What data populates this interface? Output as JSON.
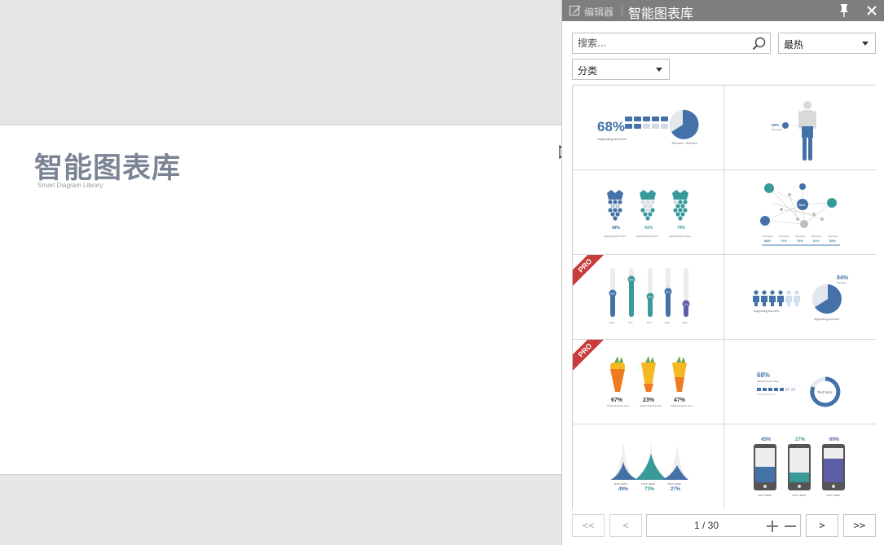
{
  "slide": {
    "title": "智能图表库",
    "subtitle": "Smart Diagram Library"
  },
  "panel": {
    "header": {
      "edit_label": "编辑器",
      "title": "智能图表库"
    },
    "search": {
      "placeholder": "搜索..."
    },
    "sort_select": {
      "value": "最热"
    },
    "category_select": {
      "value": "分类"
    },
    "templates": [
      {
        "name": "percent-pie",
        "pro": false,
        "texts": {
          "big": "68%",
          "support": "Supporting text here",
          "pie": "Text here / Text here"
        }
      },
      {
        "name": "human-body",
        "pro": false,
        "texts": {
          "pct": "68%",
          "label": "Text here"
        }
      },
      {
        "name": "grapes",
        "pro": false,
        "texts": {
          "p1": "68%",
          "p2": "41%",
          "p3": "79%",
          "support": "Supporting text here"
        }
      },
      {
        "name": "network",
        "pro": false,
        "texts": {
          "node": "Text",
          "v1": "88%",
          "v2": "73%",
          "v3": "74%",
          "v4": "64%",
          "v5": "58%",
          "label": "Text here"
        }
      },
      {
        "name": "vertical-bars",
        "pro": true,
        "texts": {
          "v1": "52%",
          "v2": "98%",
          "v3": "40%",
          "v4": "56%",
          "v5": "21%",
          "label": "Text"
        }
      },
      {
        "name": "people-pie",
        "pro": false,
        "texts": {
          "pct": "84%",
          "label": "Text here",
          "support": "Supporting text here"
        }
      },
      {
        "name": "carrots",
        "pro": true,
        "texts": {
          "p1": "67%",
          "p2": "23%",
          "p3": "47%",
          "support": "Supporting text here"
        }
      },
      {
        "name": "donut-bar",
        "pro": false,
        "texts": {
          "pct": "68%",
          "center": "Text here",
          "support": "Supporting text here"
        }
      },
      {
        "name": "mountains",
        "pro": false,
        "texts": {
          "p1": "49%",
          "p2": "73%",
          "p3": "27%",
          "label": "TEXT HERE"
        }
      },
      {
        "name": "phones",
        "pro": false,
        "texts": {
          "p1": "45%",
          "p2": "27%",
          "p3": "69%",
          "label": "TEXT HERE"
        }
      }
    ],
    "pro_label": "PRO",
    "pager": {
      "first": "<<",
      "prev": "<",
      "page": "1 / 30",
      "next": ">",
      "last": ">>"
    }
  },
  "colors": {
    "blue": "#4472a8",
    "teal": "#3a9a9a",
    "purple": "#5b5ea6",
    "orange": "#f07a22",
    "yellow": "#f5b823",
    "header_bg": "#7e7e7e",
    "pro_red": "#c83c3c"
  }
}
